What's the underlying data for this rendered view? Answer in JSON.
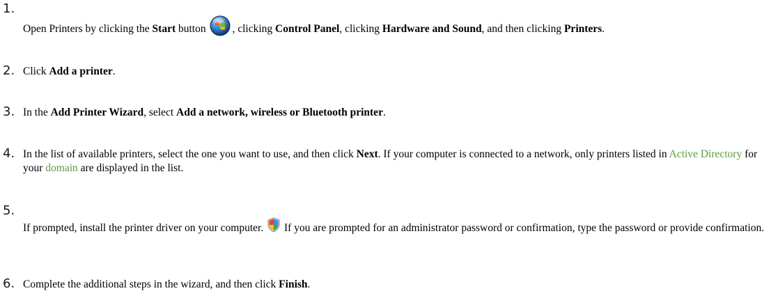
{
  "steps": [
    {
      "number": "1.",
      "t1": "Open Printers by clicking the ",
      "b1": "Start",
      "t2": " button ",
      "icon": "start-button-orb-icon",
      "t3": ", clicking ",
      "b2": "Control Panel",
      "t4": ", clicking ",
      "b3": "Hardware and Sound",
      "t5": ", and then clicking ",
      "b4": "Printers",
      "t6": "."
    },
    {
      "number": "2.",
      "t1": "Click ",
      "b1": "Add a printer",
      "t2": "."
    },
    {
      "number": "3.",
      "t1": "In the ",
      "b1": "Add Printer Wizard",
      "t2": ", select ",
      "b2": "Add a network, wireless or Bluetooth printer",
      "t3": "."
    },
    {
      "number": "4.",
      "t1": "In the list of available printers, select the one you want to use, and then click ",
      "b1": "Next",
      "t2": ". If your computer is connected to a network, only printers listed in ",
      "link1": "Active Directory",
      "t3": " for your ",
      "link2": "domain",
      "t4": " are displayed in the list."
    },
    {
      "number": "5.",
      "t1": "If prompted, install the printer driver on your computer. ",
      "icon": "security-shield-icon",
      "t2": " If you are prompted for an administrator password or confirmation, type the password or provide confirmation."
    },
    {
      "number": "6.",
      "t1": "Complete the additional steps in the wizard, and then click ",
      "b1": "Finish",
      "t2": "."
    }
  ],
  "colors": {
    "link": "#5b9a45",
    "text": "#000000",
    "background": "#ffffff"
  }
}
